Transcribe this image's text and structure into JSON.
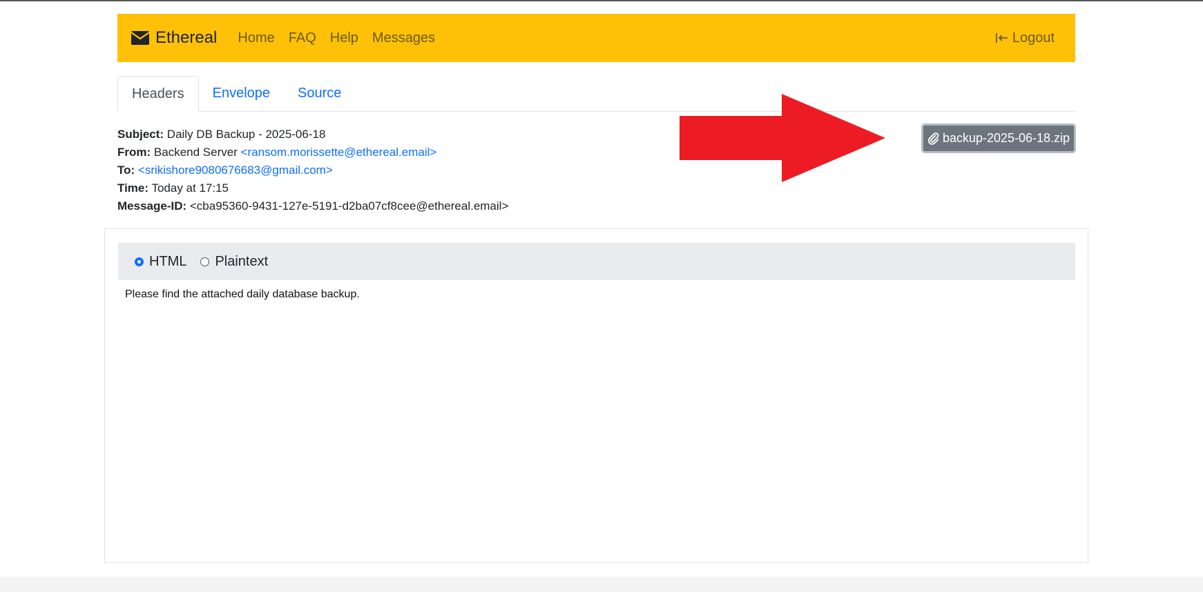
{
  "navbar": {
    "brand": "Ethereal",
    "links": [
      "Home",
      "FAQ",
      "Help",
      "Messages"
    ],
    "logout": "Logout",
    "bg_color": "#ffc107"
  },
  "tabs": [
    "Headers",
    "Envelope",
    "Source"
  ],
  "active_tab": "Headers",
  "headers": {
    "subject_key": "Subject:",
    "subject": "Daily DB Backup - 2025-06-18",
    "from_key": "From:",
    "from_name": "Backend Server",
    "from_email": "<ransom.morissette@ethereal.email>",
    "to_key": "To:",
    "to_email": "<srikishore9080676683@gmail.com>",
    "time_key": "Time:",
    "time": "Today at 17:15",
    "message_id_key": "Message-ID:",
    "message_id": "<cba95360-9431-127e-5191-d2ba07cf8cee@ethereal.email>"
  },
  "attachment": {
    "filename": "backup-2025-06-18.zip",
    "icon": "paperclip-icon"
  },
  "annotation": {
    "arrow_color": "#ed1c24"
  },
  "view_format": {
    "options": [
      "HTML",
      "Plaintext"
    ],
    "selected": "HTML"
  },
  "message_body": "Please find the attached daily database backup."
}
